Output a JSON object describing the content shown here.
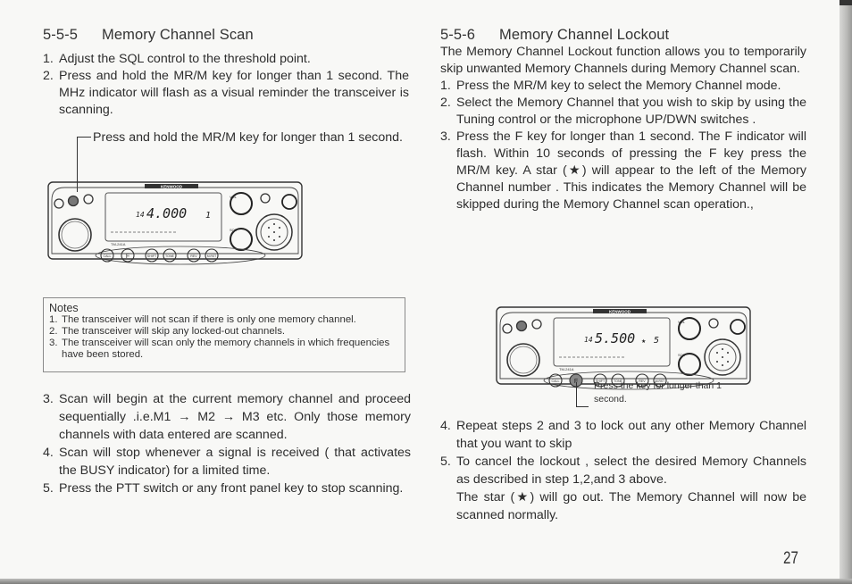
{
  "left_section": {
    "number": "5-5-5",
    "title": "Memory Channel Scan",
    "steps_top": [
      {
        "n": "1.",
        "text": "Adjust the SQL control to the threshold point."
      },
      {
        "n": "2.",
        "text": "Press and hold the MR/M key for longer than 1 second. The MHz indicator will flash as a visual reminder the transceiver is scanning."
      }
    ],
    "callout": "Press and hold the MR/M key for longer than 1 second.",
    "radio": {
      "brand": "KENWOOD",
      "model": "TM-241A",
      "frequency_prefix": "14",
      "frequency_main": "4.000",
      "channel": "1",
      "star": "",
      "buttons": [
        "CALL",
        "F",
        "SHIFT",
        "TONE",
        "REV",
        "M.RST"
      ],
      "button_labels_above": [
        "AL",
        "T.ALT",
        "STEP"
      ],
      "knob_labels": [
        "VOL",
        "SQL",
        "LOW",
        "DIM",
        "POWER",
        "MHz",
        "MR",
        "M",
        "MR/L",
        "LOCK",
        "MHz"
      ],
      "highlighted_key": "MR/M"
    },
    "notes": {
      "title": "Notes",
      "items": [
        {
          "n": "1.",
          "text": "The transceiver will not scan if there is only one memory channel."
        },
        {
          "n": "2.",
          "text": "The transceiver will skip any locked-out channels."
        },
        {
          "n": "3.",
          "text": "The transceiver will scan only the memory channels in which frequencies have been stored."
        }
      ]
    },
    "steps_bottom": [
      {
        "n": "3.",
        "text": "Scan will begin at the current memory channel and proceed sequentially .i.e.M1 → M2 → M3 etc. Only those memory channels with data entered are scanned."
      },
      {
        "n": "4.",
        "text": "Scan will stop whenever a signal is received ( that activates the BUSY indicator) for a limited time."
      },
      {
        "n": "5.",
        "text": "Press the PTT switch or any front panel key to stop scanning."
      }
    ]
  },
  "right_section": {
    "number": "5-5-6",
    "title": "Memory Channel Lockout",
    "intro": "The Memory Channel Lockout function allows you to temporarily skip unwanted Memory Channels during Memory Channel scan.",
    "steps_top": [
      {
        "n": "1.",
        "text": "Press the MR/M key to select the Memory Channel mode."
      },
      {
        "n": "2.",
        "text": "Select the Memory Channel that you wish to skip by using the Tuning control or the microphone UP/DWN switches ."
      },
      {
        "n": "3.",
        "text": "Press the F key for longer than 1 second. The F indicator will flash. Within 10 seconds of pressing the F key press the MR/M key. A star (★) will appear to the left of the Memory Channel number . This indicates the Memory Channel will be skipped during the Memory Channel scan operation.,"
      }
    ],
    "radio": {
      "brand": "KENWOOD",
      "model": "TM-241A",
      "frequency_prefix": "14",
      "frequency_main": "5.500",
      "channel": "5",
      "star": "★",
      "buttons": [
        "CALL",
        "F",
        "SHIFT",
        "TONE",
        "REV",
        "M.RST"
      ],
      "button_labels_above": [
        "AL",
        "T.ALT",
        "STEP"
      ],
      "highlighted_key": "F"
    },
    "callout": "Press the key for longer than 1 second.",
    "steps_bottom": [
      {
        "n": "4.",
        "text": "Repeat steps 2 and 3 to lock out any other Memory Channel that you want to skip"
      },
      {
        "n": "5.",
        "text": "To cancel the lockout , select the desired Memory Channels as described in step 1,2,and 3 above."
      }
    ],
    "closing": "The star (★) will go out. The Memory Channel will now be scanned normally."
  },
  "page_number": "27"
}
